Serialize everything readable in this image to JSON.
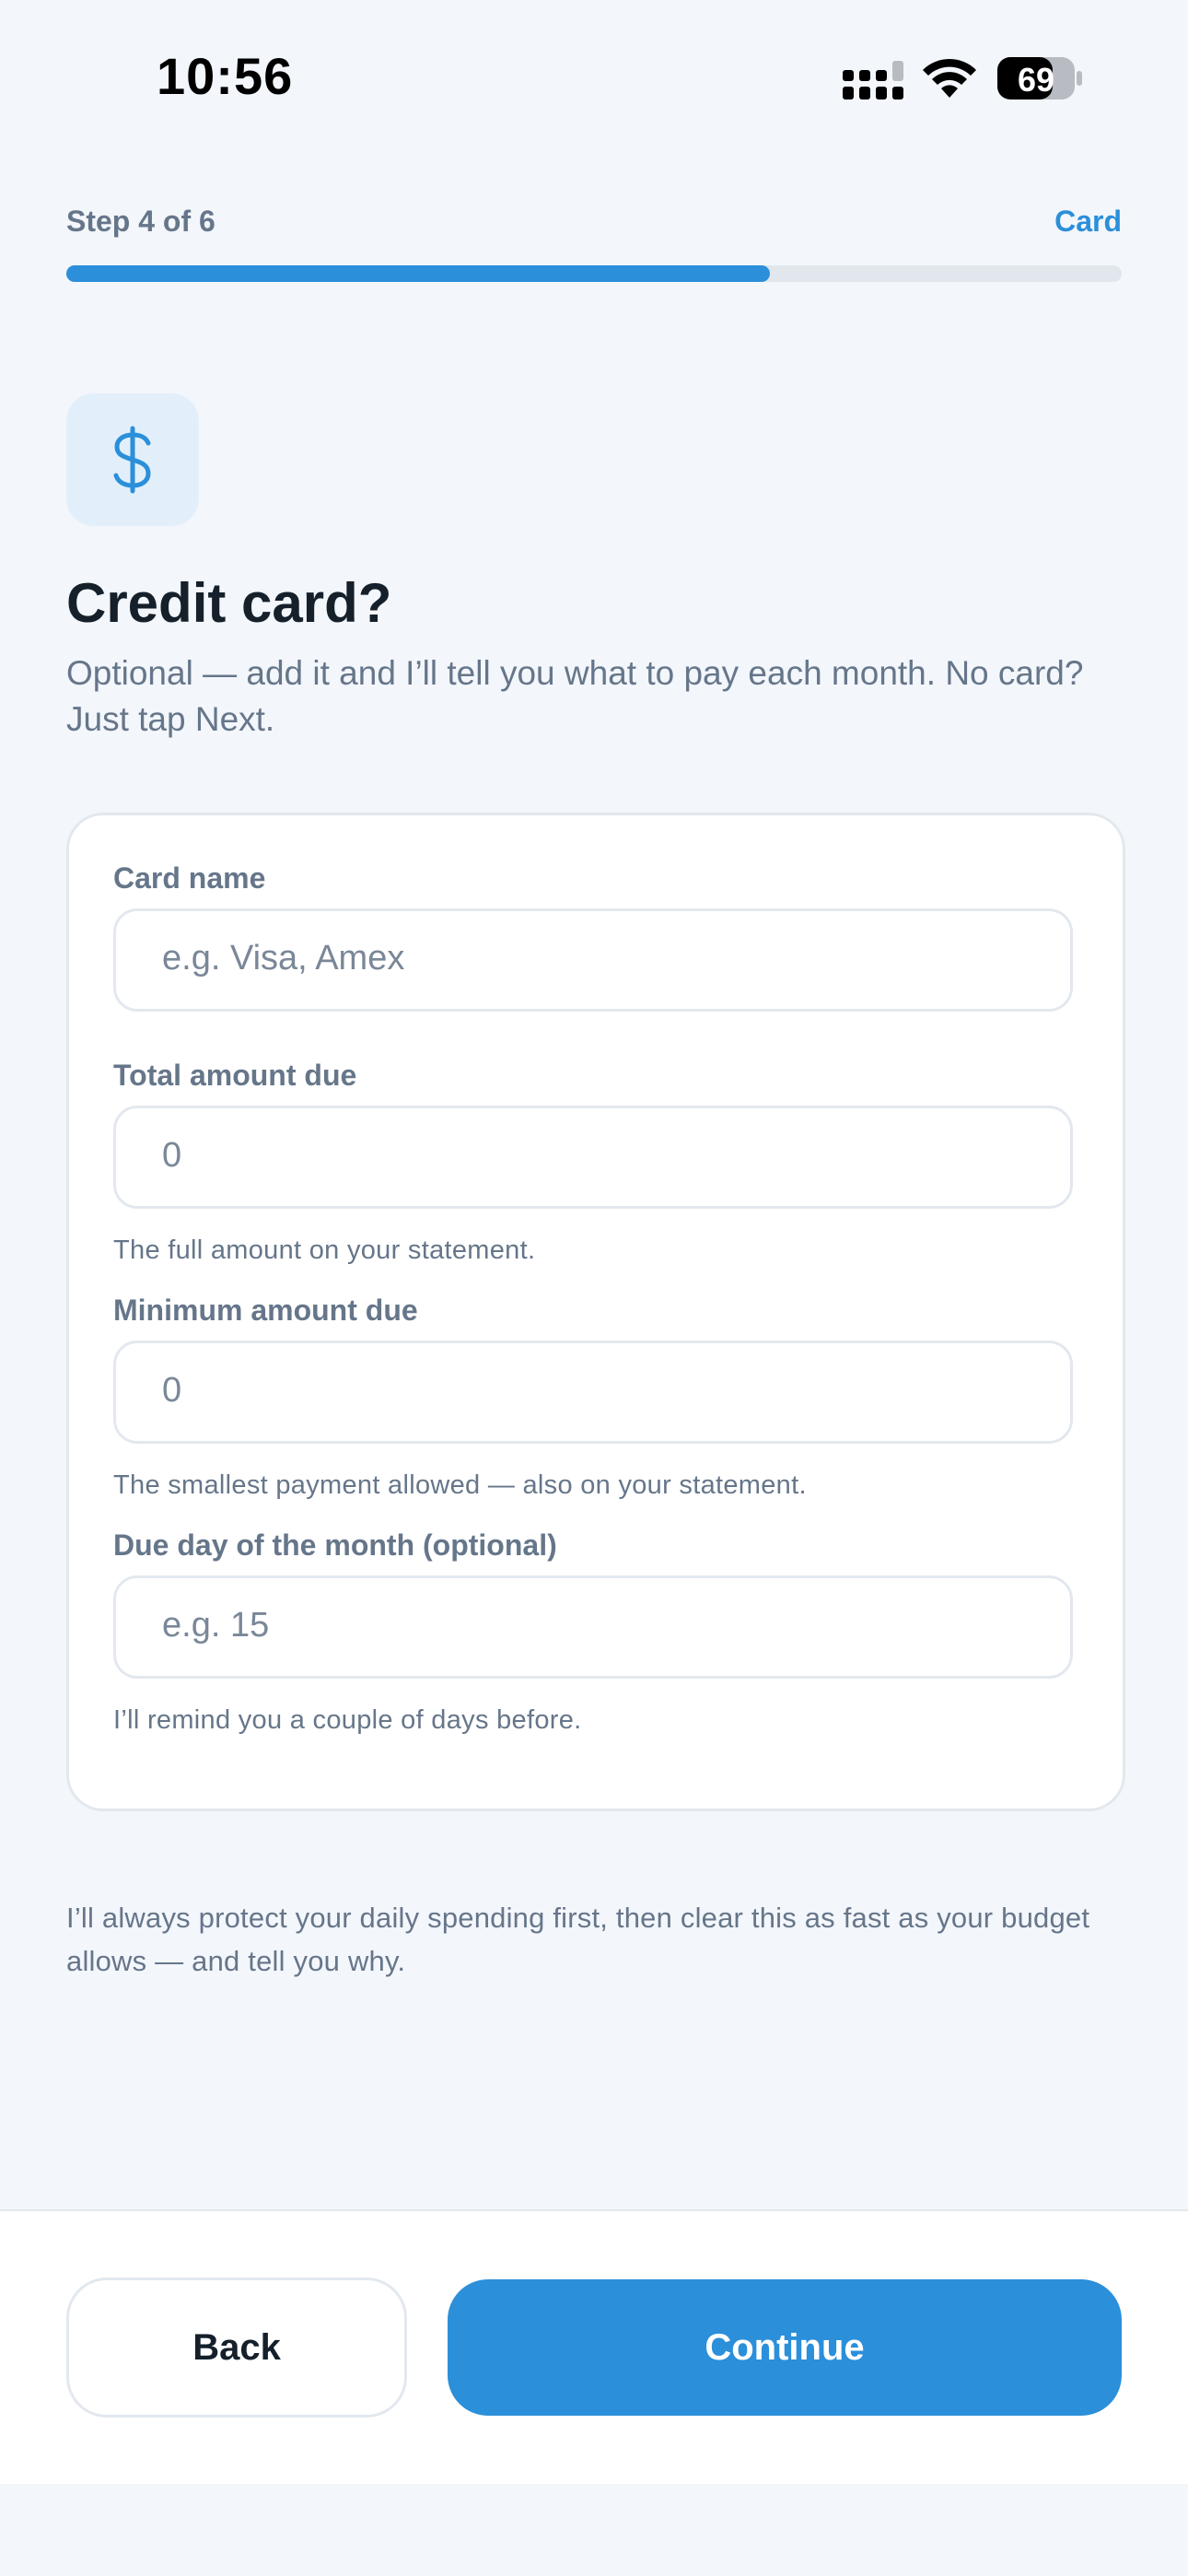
{
  "status_bar": {
    "time": "10:56",
    "battery_level": "69"
  },
  "progress": {
    "step_label": "Step 4 of 6",
    "step_name": "Card",
    "fraction": 0.667
  },
  "header": {
    "icon": "dollar-icon",
    "title": "Credit card?",
    "subtitle": "Optional — add it and I’ll tell you what to pay each month. No card? Just tap Next."
  },
  "form": {
    "card_name": {
      "label": "Card name",
      "placeholder": "e.g. Visa, Amex"
    },
    "total_due": {
      "label": "Total amount due",
      "value": "0",
      "hint": "The full amount on your statement."
    },
    "minimum_due": {
      "label": "Minimum amount due",
      "value": "0",
      "hint": "The smallest payment allowed — also on your statement."
    },
    "due_day": {
      "label": "Due day of the month (optional)",
      "placeholder": "e.g. 15",
      "hint": "I’ll remind you a couple of days before."
    }
  },
  "footer_note": "I’ll always protect your daily spending first, then clear this as fast as your budget allows — and tell you why.",
  "actions": {
    "back_label": "Back",
    "continue_label": "Continue"
  },
  "colors": {
    "accent": "#2b8fda",
    "background": "#f3f6fb",
    "muted_text": "#66768a"
  }
}
